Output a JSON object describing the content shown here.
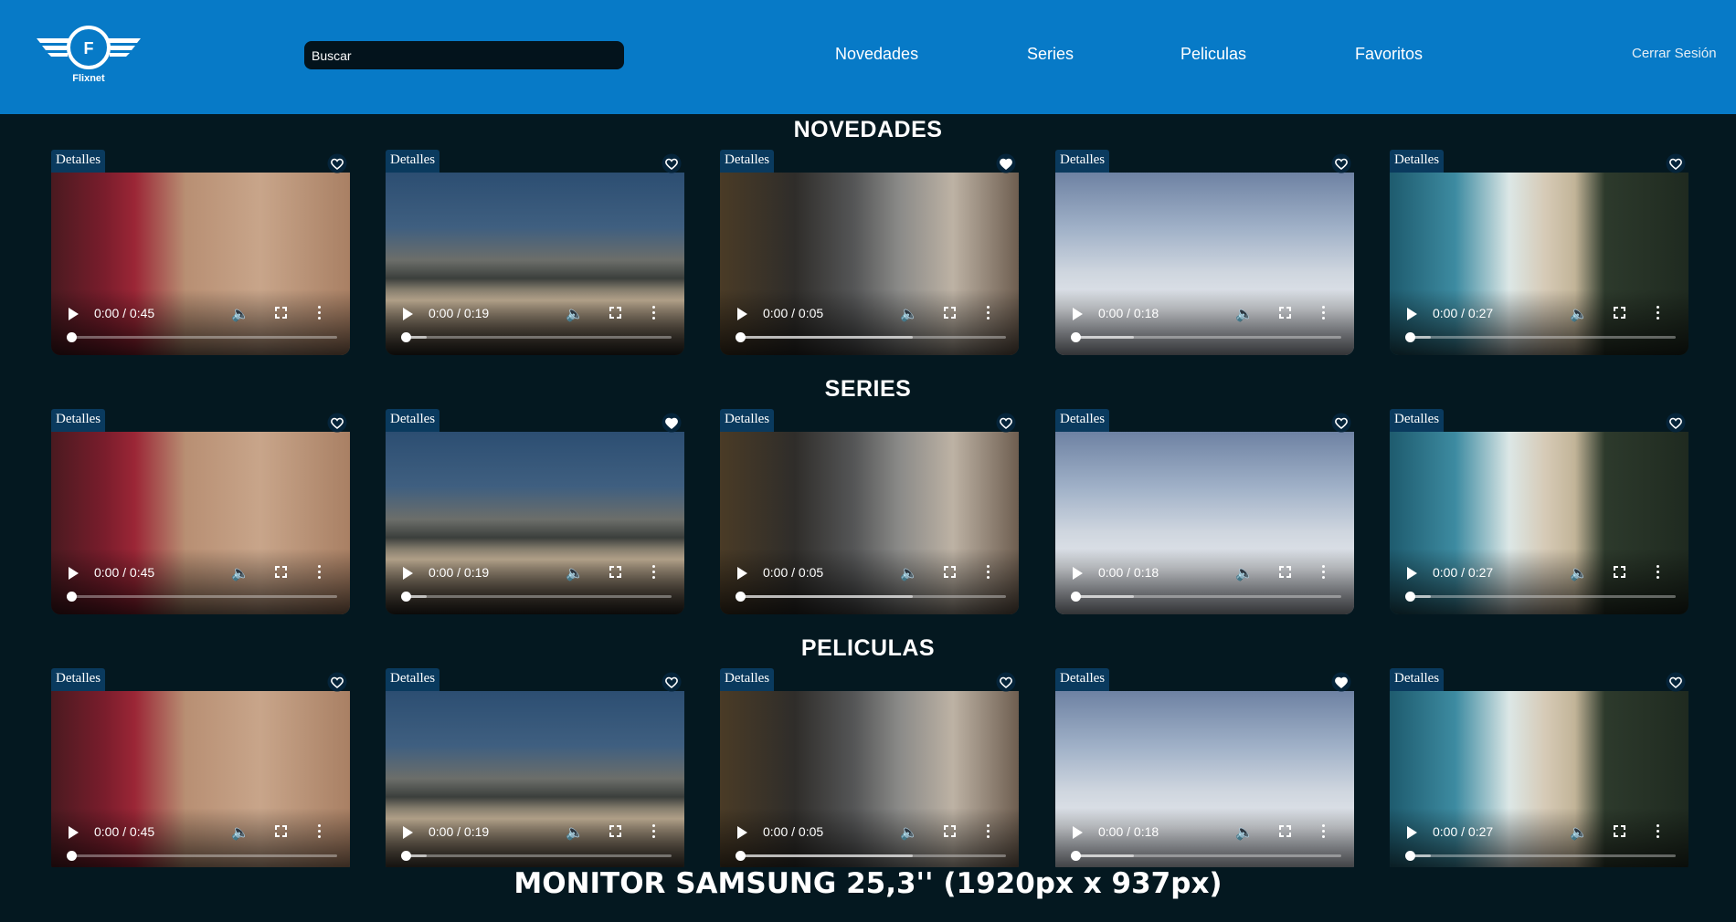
{
  "header": {
    "brand": "Flixnet",
    "logo_letter": "F",
    "search_placeholder": "Buscar",
    "nav": [
      {
        "label": "Novedades"
      },
      {
        "label": "Series"
      },
      {
        "label": "Peliculas"
      },
      {
        "label": "Favoritos"
      }
    ],
    "logout_label": "Cerrar Sesión"
  },
  "sections": [
    {
      "title": "NOVEDADES",
      "cards": [
        {
          "details_label": "Detalles",
          "time": "0:00 / 0:45",
          "favorite": false,
          "scene": "tea",
          "muted_icon": false,
          "buffered": 0
        },
        {
          "details_label": "Detalles",
          "time": "0:00 / 0:19",
          "favorite": false,
          "scene": "fog",
          "muted_icon": true,
          "buffered": 0.08
        },
        {
          "details_label": "Detalles",
          "time": "0:00 / 0:05",
          "favorite": true,
          "scene": "city",
          "muted_icon": true,
          "buffered": 0.65
        },
        {
          "details_label": "Detalles",
          "time": "0:00 / 0:18",
          "favorite": false,
          "scene": "clouds",
          "muted_icon": false,
          "buffered": 0.22
        },
        {
          "details_label": "Detalles",
          "time": "0:00 / 0:27",
          "favorite": false,
          "scene": "beach",
          "muted_icon": true,
          "buffered": 0.08
        }
      ]
    },
    {
      "title": "SERIES",
      "cards": [
        {
          "details_label": "Detalles",
          "time": "0:00 / 0:45",
          "favorite": false,
          "scene": "tea",
          "muted_icon": false,
          "buffered": 0
        },
        {
          "details_label": "Detalles",
          "time": "0:00 / 0:19",
          "favorite": true,
          "scene": "fog",
          "muted_icon": true,
          "buffered": 0.08
        },
        {
          "details_label": "Detalles",
          "time": "0:00 / 0:05",
          "favorite": false,
          "scene": "city",
          "muted_icon": true,
          "buffered": 0.65
        },
        {
          "details_label": "Detalles",
          "time": "0:00 / 0:18",
          "favorite": false,
          "scene": "clouds",
          "muted_icon": false,
          "buffered": 0.22
        },
        {
          "details_label": "Detalles",
          "time": "0:00 / 0:27",
          "favorite": false,
          "scene": "beach",
          "muted_icon": true,
          "buffered": 0.08
        }
      ]
    },
    {
      "title": "PELICULAS",
      "cards": [
        {
          "details_label": "Detalles",
          "time": "0:00 / 0:45",
          "favorite": false,
          "scene": "tea",
          "muted_icon": false,
          "buffered": 0
        },
        {
          "details_label": "Detalles",
          "time": "0:00 / 0:19",
          "favorite": false,
          "scene": "fog",
          "muted_icon": true,
          "buffered": 0.08
        },
        {
          "details_label": "Detalles",
          "time": "0:00 / 0:05",
          "favorite": false,
          "scene": "city",
          "muted_icon": true,
          "buffered": 0.65
        },
        {
          "details_label": "Detalles",
          "time": "0:00 / 0:18",
          "favorite": true,
          "scene": "clouds",
          "muted_icon": false,
          "buffered": 0.22
        },
        {
          "details_label": "Detalles",
          "time": "0:00 / 0:27",
          "favorite": false,
          "scene": "beach",
          "muted_icon": true,
          "buffered": 0.08
        }
      ]
    }
  ],
  "footer_note": "MONITOR SAMSUNG 25,3'' (1920px x 937px)",
  "colors": {
    "header_bg": "#077ac7",
    "page_bg": "#041820",
    "details_bg": "#0a3a5e"
  }
}
